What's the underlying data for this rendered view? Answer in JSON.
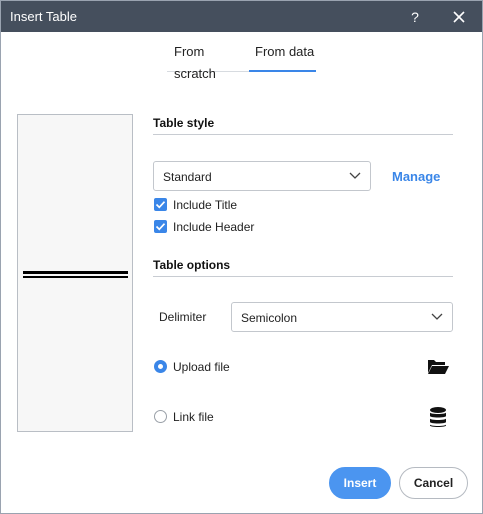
{
  "window": {
    "title": "Insert Table",
    "help_label": "?",
    "close_icon": "close-icon"
  },
  "tabs": [
    {
      "label": "From scratch",
      "active": false
    },
    {
      "label": "From data",
      "active": true
    }
  ],
  "table_style": {
    "title": "Table style",
    "style_select": {
      "value": "Standard",
      "icon": "chevron-down-icon"
    },
    "manage_label": "Manage",
    "include_title": {
      "label": "Include Title",
      "checked": true
    },
    "include_header": {
      "label": "Include Header",
      "checked": true
    }
  },
  "table_options": {
    "title": "Table options",
    "delimiter_label": "Delimiter",
    "delimiter_select": {
      "value": "Semicolon",
      "icon": "chevron-down-icon"
    },
    "upload_file": {
      "label": "Upload file",
      "selected": true,
      "icon": "folder-open-icon"
    },
    "link_file": {
      "label": "Link file",
      "selected": false,
      "icon": "database-icon"
    }
  },
  "buttons": {
    "insert_label": "Insert",
    "cancel_label": "Cancel"
  },
  "colors": {
    "titlebar": "#454f5d",
    "accent": "#3a86e8",
    "insert_button": "#4b95f0"
  }
}
